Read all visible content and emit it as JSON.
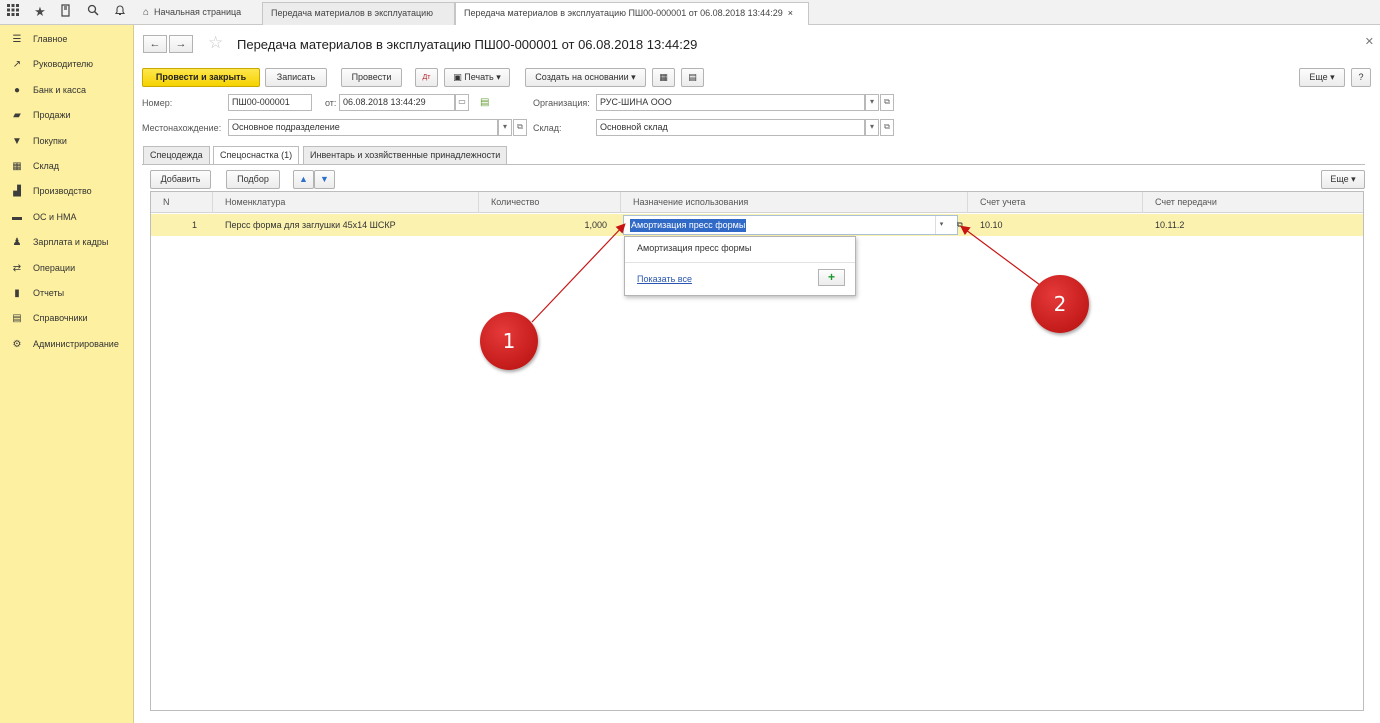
{
  "topbar": {
    "tabs": [
      {
        "label": "Начальная страница"
      },
      {
        "label": "Передача материалов в эксплуатацию"
      },
      {
        "label": "Передача материалов в эксплуатацию ПШ00-000001 от 06.08.2018 13:44:29"
      }
    ],
    "close_glyph": "×"
  },
  "sidebar": {
    "items": [
      {
        "label": "Главное",
        "icon": "menu-icon"
      },
      {
        "label": "Руководителю",
        "icon": "trend-icon"
      },
      {
        "label": "Банк и касса",
        "icon": "coins-icon"
      },
      {
        "label": "Продажи",
        "icon": "bag-icon"
      },
      {
        "label": "Покупки",
        "icon": "cart-icon"
      },
      {
        "label": "Склад",
        "icon": "warehouse-icon"
      },
      {
        "label": "Производство",
        "icon": "factory-icon"
      },
      {
        "label": "ОС и НМА",
        "icon": "truck-icon"
      },
      {
        "label": "Зарплата и кадры",
        "icon": "person-icon"
      },
      {
        "label": "Операции",
        "icon": "operations-icon"
      },
      {
        "label": "Отчеты",
        "icon": "bar-chart-icon"
      },
      {
        "label": "Справочники",
        "icon": "book-icon"
      },
      {
        "label": "Администрирование",
        "icon": "gear-icon"
      }
    ]
  },
  "form": {
    "title": "Передача материалов в эксплуатацию ПШ00-000001 от 06.08.2018 13:44:29",
    "toolbar": {
      "post_close": "Провести и закрыть",
      "save": "Записать",
      "post": "Провести",
      "print": "Печать",
      "create_based": "Создать на основании",
      "more": "Еще",
      "help": "?"
    },
    "number_label": "Номер:",
    "number_value": "ПШ00-000001",
    "date_label": "от:",
    "date_value": "06.08.2018 13:44:29",
    "org_label": "Организация:",
    "org_value": "РУС-ШИНА ООО",
    "location_label": "Местонахождение:",
    "location_value": "Основное подразделение",
    "warehouse_label": "Склад:",
    "warehouse_value": "Основной склад"
  },
  "doc_tabs": [
    {
      "label": "Спецодежда"
    },
    {
      "label": "Спецоснастка (1)"
    },
    {
      "label": "Инвентарь и хозяйственные принадлежности"
    }
  ],
  "table_toolbar": {
    "add": "Добавить",
    "pick": "Подбор",
    "more": "Еще"
  },
  "table": {
    "columns": [
      "N",
      "Номенклатура",
      "Количество",
      "Назначение использования",
      "Счет учета",
      "Счет передачи"
    ],
    "rows": [
      {
        "n": "1",
        "item": "Персс форма для заглушки 45х14 ШСКР",
        "qty": "1,000",
        "purpose": "Амортизация пресс формы",
        "account": "10.10",
        "transfer_account": "10.11.2"
      }
    ]
  },
  "popup": {
    "option": "Амортизация пресс формы",
    "show_all": "Показать все",
    "add": "+"
  },
  "callouts": [
    "1",
    "2"
  ],
  "colors": {
    "sidebar_bg": "#fdf0a0",
    "primary_btn": "#f5d200",
    "row_highlight": "#fbf2b0",
    "callout": "#c91414",
    "selection": "#3169c6"
  }
}
